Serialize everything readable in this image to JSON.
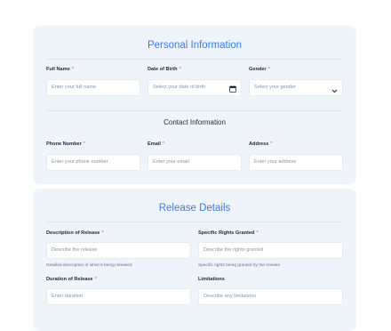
{
  "personal": {
    "title": "Personal Information",
    "full_name": {
      "label": "Full Name",
      "required": "*",
      "placeholder": "Enter your full name"
    },
    "dob": {
      "label": "Date of Birth",
      "required": "*",
      "placeholder": "Select your date of birth",
      "icon": "calendar-icon"
    },
    "gender": {
      "label": "Gender",
      "required": "*",
      "placeholder": "Select your gender",
      "icon": "chevron-down-icon"
    }
  },
  "contact": {
    "title": "Contact Information",
    "phone": {
      "label": "Phone Number",
      "required": "*",
      "placeholder": "Enter your phone number"
    },
    "email": {
      "label": "Email",
      "required": "*",
      "placeholder": "Enter your email"
    },
    "address": {
      "label": "Address",
      "required": "*",
      "placeholder": "Enter your address"
    }
  },
  "release": {
    "title": "Release Details",
    "description": {
      "label": "Description of Release",
      "required": "*",
      "placeholder": "Describe the release",
      "hint": "Detailed description of what is being released"
    },
    "rights": {
      "label": "Specific Rights Granted",
      "required": "*",
      "placeholder": "Describe the rights granted",
      "hint": "Specific rights being granted by the release"
    },
    "duration": {
      "label": "Duration of Release",
      "required": "*",
      "placeholder": "Enter duration"
    },
    "limitations": {
      "label": "Limitations",
      "placeholder": "Describe any limitations"
    }
  }
}
